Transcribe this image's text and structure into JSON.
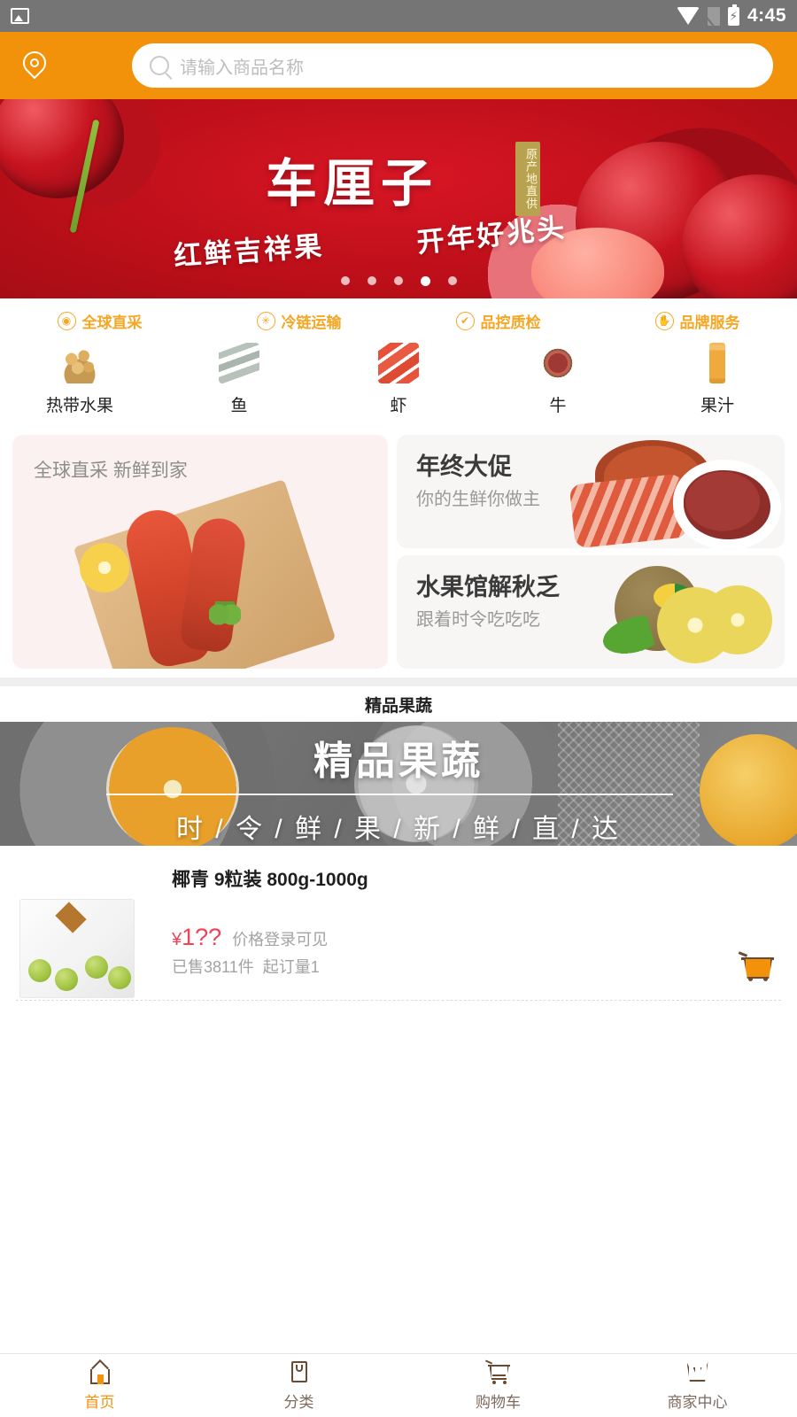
{
  "statusbar": {
    "time": "4:45",
    "battery_glyph": "⚡",
    "icons": [
      "photo-icon",
      "wifi-icon",
      "signal-icon",
      "battery-icon"
    ]
  },
  "header": {
    "location_icon": "location-pin-icon",
    "search": {
      "icon": "search-icon",
      "placeholder": "请输入商品名称",
      "value": ""
    }
  },
  "banner": {
    "title": "车厘子",
    "badge": "原产地直供",
    "subtitle_left": "红鲜吉祥果",
    "subtitle_right": "开年好兆头",
    "dots_total": 5,
    "dot_active_index": 3
  },
  "services": [
    {
      "icon": "globe-icon",
      "glyph": "◉",
      "label": "全球直采"
    },
    {
      "icon": "snowflake-icon",
      "glyph": "✳",
      "label": "冷链运输"
    },
    {
      "icon": "shield-icon",
      "glyph": "✔",
      "label": "品控质检"
    },
    {
      "icon": "handshake-icon",
      "glyph": "✋",
      "label": "品牌服务"
    }
  ],
  "categories": [
    {
      "label": "热带水果",
      "image": "tropical-fruit-photo"
    },
    {
      "label": "鱼",
      "image": "fish-photo"
    },
    {
      "label": "虾",
      "image": "shrimp-photo"
    },
    {
      "label": "牛",
      "image": "beef-photo"
    },
    {
      "label": "果汁",
      "image": "juice-bottle-photo"
    }
  ],
  "promos": {
    "left": {
      "title": "全球直采 新鲜到家",
      "image": "lobster-photo"
    },
    "right_top": {
      "title": "年终大促",
      "subtitle": "你的生鲜你做主",
      "image": "crab-steak-photo"
    },
    "right_bottom": {
      "title": "水果馆解秋乏",
      "subtitle": "跟着时令吃吃吃",
      "image": "kiwi-photo"
    }
  },
  "section": {
    "title": "精品果蔬",
    "banner_title": "精品果蔬",
    "banner_subtitle": "时 / 令 / 鲜 / 果 / 新 / 鲜 / 直 / 达"
  },
  "products": [
    {
      "title": "椰青 9粒装 800g-1000g",
      "price": "1??",
      "currency": "¥",
      "price_note": "价格登录可见",
      "sold": "已售3811件",
      "min_order": "起订量1",
      "cart_icon": "add-to-cart-icon",
      "image": "coconut-box-photo"
    }
  ],
  "bottom_nav": [
    {
      "icon": "home-icon",
      "label": "首页",
      "active": true
    },
    {
      "icon": "grid-icon",
      "label": "分类",
      "active": false
    },
    {
      "icon": "cart-icon",
      "label": "购物车",
      "active": false
    },
    {
      "icon": "shop-icon",
      "label": "商家中心",
      "active": false
    }
  ],
  "colors": {
    "accent_orange": "#F2920A",
    "service_orange": "#F5A623",
    "price_red": "#F0435A",
    "statusbar_gray": "#757575",
    "nav_brown": "#6B4A32",
    "muted_gray": "#A3A3A3"
  }
}
